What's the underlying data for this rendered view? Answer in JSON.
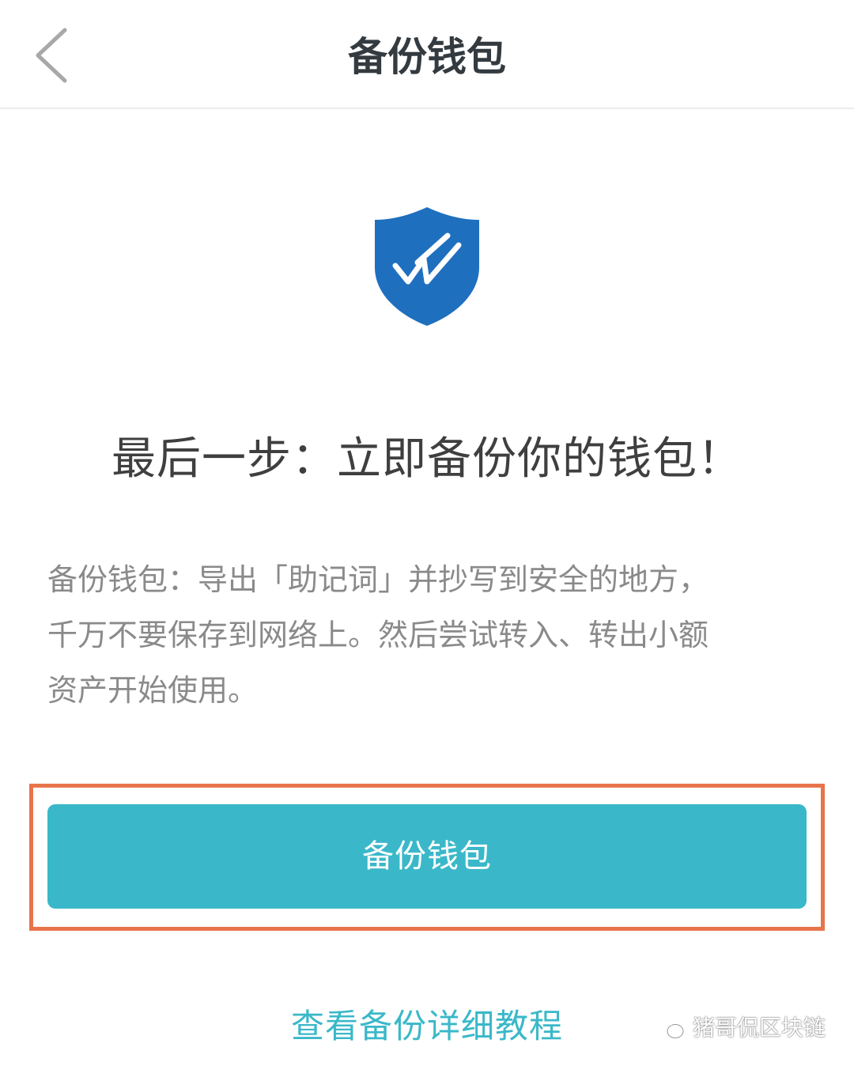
{
  "header": {
    "title": "备份钱包",
    "back_icon": "chevron-left-icon"
  },
  "shield": {
    "icon": "shield-check-icon",
    "color": "#1f6fbf"
  },
  "headline": "最后一步：立即备份你的钱包！",
  "description": {
    "lines": [
      "备份钱包：导出「助记词」并抄写到安全的地方，",
      "千万不要保存到网络上。然后尝试转入、转出小额",
      "资产开始使用。"
    ]
  },
  "backup_button": {
    "label": "备份钱包",
    "color": "#3ab8c9"
  },
  "highlight_color": "#e8744b",
  "tutorial_link": {
    "label": "查看备份详细教程"
  },
  "watermark": {
    "icon": "wechat-icon",
    "text": "猪哥侃区块链"
  }
}
